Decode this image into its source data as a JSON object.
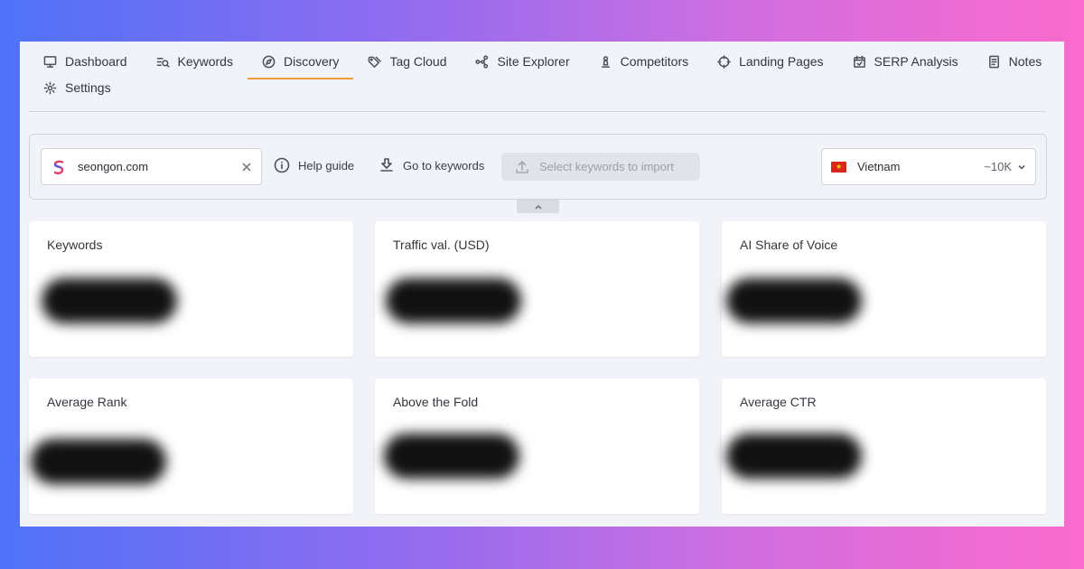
{
  "nav": {
    "tabs": [
      {
        "label": "Dashboard",
        "icon": "monitor-icon"
      },
      {
        "label": "Keywords",
        "icon": "keyword-search-icon"
      },
      {
        "label": "Discovery",
        "icon": "compass-icon",
        "active": true
      },
      {
        "label": "Tag Cloud",
        "icon": "tag-icon"
      },
      {
        "label": "Site Explorer",
        "icon": "sitemap-icon"
      },
      {
        "label": "Competitors",
        "icon": "chess-pawn-icon"
      },
      {
        "label": "Landing Pages",
        "icon": "crosshair-icon"
      },
      {
        "label": "SERP Analysis",
        "icon": "calendar-check-icon"
      },
      {
        "label": "Notes",
        "icon": "notes-icon"
      },
      {
        "label": "Settings",
        "icon": "gear-icon"
      }
    ],
    "active_color": "#f39a3c"
  },
  "toolbar": {
    "domain": "seongon.com",
    "help_label": "Help guide",
    "go_keywords_label": "Go to keywords",
    "import_label": "Select keywords to import",
    "country": "Vietnam",
    "volume": "~10K"
  },
  "metrics": [
    {
      "title": "Keywords"
    },
    {
      "title": "Traffic val. (USD)"
    },
    {
      "title": "AI Share of Voice"
    },
    {
      "title": "Average Rank"
    },
    {
      "title": "Above the Fold"
    },
    {
      "title": "Average CTR"
    }
  ]
}
